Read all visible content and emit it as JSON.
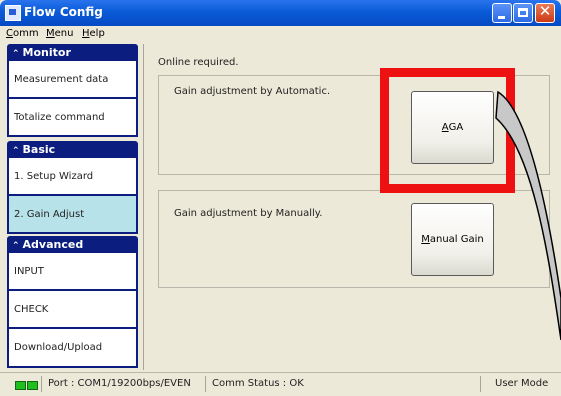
{
  "window": {
    "title": "Flow Config"
  },
  "menu": [
    {
      "mnemonic": "C",
      "rest": "omm"
    },
    {
      "mnemonic": "M",
      "rest": "enu"
    },
    {
      "mnemonic": "H",
      "rest": "elp"
    }
  ],
  "nav": {
    "groups": [
      {
        "title": "Monitor",
        "items": [
          "Measurement data",
          "Totalize command"
        ]
      },
      {
        "title": "Basic",
        "items": [
          "1. Setup Wizard",
          "2. Gain Adjust"
        ]
      },
      {
        "title": "Advanced",
        "items": [
          "INPUT",
          "CHECK",
          "Download/Upload"
        ]
      }
    ],
    "selected": "2. Gain Adjust"
  },
  "main": {
    "online_note": "Online required.",
    "auto": {
      "label": "Gain adjustment by Automatic.",
      "button_mnemonic": "A",
      "button_rest": "GA"
    },
    "manual": {
      "label": "Gain adjustment by Manually.",
      "button_mnemonic": "M",
      "button_rest": "anual Gain"
    }
  },
  "status": {
    "port": "Port : COM1/19200bps/EVEN",
    "comm": "Comm Status :  OK",
    "mode": "User Mode"
  },
  "colors": {
    "nav_header": "#0b1d7e",
    "nav_selected": "#b8e2ea",
    "highlight": "#ee1111",
    "led": "#1fbf1f"
  }
}
